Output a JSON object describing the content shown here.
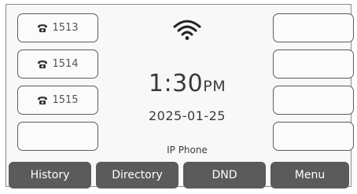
{
  "line_keys_left": [
    {
      "label": "1513",
      "icon": "phone-icon"
    },
    {
      "label": "1514",
      "icon": "phone-icon"
    },
    {
      "label": "1515",
      "icon": "phone-icon"
    },
    {
      "label": "",
      "icon": ""
    }
  ],
  "line_keys_right": [
    {
      "label": ""
    },
    {
      "label": ""
    },
    {
      "label": ""
    },
    {
      "label": ""
    }
  ],
  "status": {
    "wifi_icon": "wifi-icon"
  },
  "clock": {
    "time": "1:30",
    "ampm": "PM",
    "date": "2025-01-25"
  },
  "device": {
    "model": "IP Phone"
  },
  "softkeys": [
    {
      "label": "History"
    },
    {
      "label": "Directory"
    },
    {
      "label": "DND"
    },
    {
      "label": "Menu"
    }
  ],
  "colors": {
    "softkey_bg": "#5b5b5b",
    "key_border": "#5c5c5c",
    "text": "#3a3a3a"
  }
}
